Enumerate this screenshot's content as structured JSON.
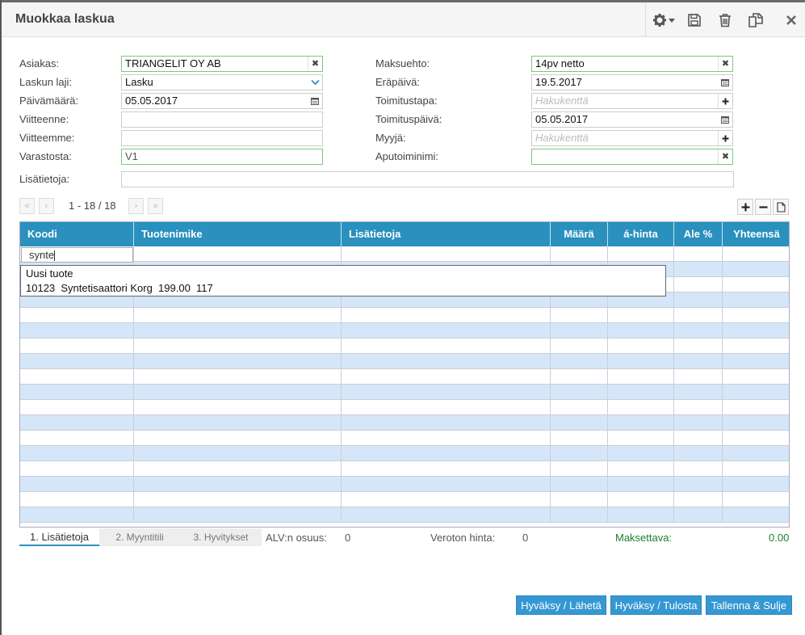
{
  "window": {
    "title": "Muokkaa laskua"
  },
  "icons": {
    "gear": "gear-icon",
    "save": "save-icon",
    "trash": "trash-icon",
    "copy": "copy-icon",
    "close": "close-icon"
  },
  "form": {
    "customer": {
      "label": "Asiakas:",
      "value": "TRIANGELIT OY AB"
    },
    "invoice_type": {
      "label": "Laskun laji:",
      "value": "Lasku"
    },
    "date": {
      "label": "Päivämäärä:",
      "value": "05.05.2017"
    },
    "our_ref": {
      "label": "Viitteenne:",
      "value": ""
    },
    "your_ref": {
      "label": "Viitteemme:",
      "value": ""
    },
    "warehouse": {
      "label": "Varastosta:",
      "value": "V1"
    },
    "extra": {
      "label": "Lisätietoja:",
      "value": ""
    },
    "payment_terms": {
      "label": "Maksuehto:",
      "value": "14pv netto"
    },
    "due_date": {
      "label": "Eräpäivä:",
      "value": "19.5.2017"
    },
    "delivery_method": {
      "label": "Toimitustapa:",
      "placeholder": "Hakukenttä"
    },
    "delivery_date": {
      "label": "Toimituspäivä:",
      "value": "05.05.2017"
    },
    "seller": {
      "label": "Myyjä:",
      "placeholder": "Hakukenttä"
    },
    "aux_name": {
      "label": "Aputoiminimi:",
      "value": ""
    }
  },
  "pager": {
    "info": "1 - 18 / 18",
    "first": "«",
    "prev": "‹",
    "next": "›",
    "last": "»"
  },
  "grid_tools": {
    "add": "+",
    "remove": "−"
  },
  "grid": {
    "columns": [
      "Koodi",
      "Tuotenimike",
      "Lisätietoja",
      "Määrä",
      "á-hinta",
      "Ale %",
      "Yhteensä"
    ],
    "editing_value": "synte",
    "colors": {
      "header": "#2a90bd",
      "stripe": "#d6e6f9"
    }
  },
  "autocomplete": {
    "items": [
      "Uusi tuote",
      "10123  Syntetisaattori Korg  199.00  117"
    ]
  },
  "tabs": [
    "1. Lisätietoja",
    "2. Myyntitili",
    "3. Hyvitykset"
  ],
  "totals": {
    "vat_label": "ALV:n osuus:",
    "vat_value": "0",
    "net_label": "Veroton hinta:",
    "net_value": "0",
    "pay_label": "Maksettava:",
    "pay_value": "0.00"
  },
  "actions": {
    "approve_send": "Hyväksy / Lähetä",
    "approve_print": "Hyväksy / Tulosta",
    "save_close": "Tallenna & Sulje"
  }
}
